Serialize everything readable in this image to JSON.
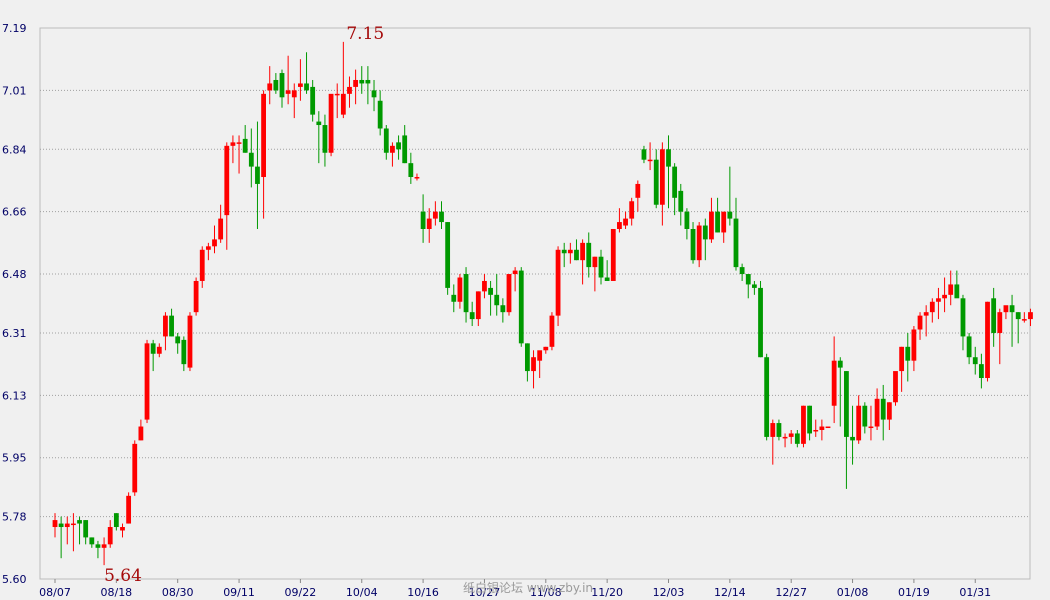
{
  "chart_data": {
    "type": "candlestick",
    "colors": {
      "up": "#ff0000",
      "down": "#009900",
      "grid": "#a0a0a0",
      "axis_label": "#000066",
      "extreme_label": "#a50a0a"
    },
    "grid": true,
    "ylim": [
      5.6,
      7.19
    ],
    "y_ticks": [
      "7.19",
      "7.01",
      "6.84",
      "6.66",
      "6.48",
      "6.31",
      "6.13",
      "5.95",
      "5.78",
      "5.60"
    ],
    "x_tick_labels": [
      "08/07",
      "08/18",
      "08/30",
      "09/11",
      "09/22",
      "10/04",
      "10/16",
      "10/27",
      "11/08",
      "11/20",
      "12/03",
      "12/14",
      "12/27",
      "01/08",
      "01/19",
      "01/31"
    ],
    "x_tick_index": [
      0,
      10,
      20,
      30,
      40,
      50,
      60,
      70,
      80,
      90,
      100,
      110,
      120,
      130,
      140,
      150
    ],
    "annotations": {
      "max_label": "7.15",
      "max_index": 47,
      "min_label": "5.64",
      "min_index": 8
    },
    "watermark": "纸白银论坛 www.zby.in",
    "candles": [
      [
        5.75,
        5.79,
        5.72,
        5.77
      ],
      [
        5.76,
        5.78,
        5.66,
        5.75
      ],
      [
        5.75,
        5.78,
        5.7,
        5.76
      ],
      [
        5.76,
        5.79,
        5.68,
        5.76
      ],
      [
        5.77,
        5.78,
        5.7,
        5.76
      ],
      [
        5.77,
        5.77,
        5.7,
        5.72
      ],
      [
        5.72,
        5.72,
        5.69,
        5.7
      ],
      [
        5.7,
        5.71,
        5.66,
        5.69
      ],
      [
        5.69,
        5.72,
        5.64,
        5.7
      ],
      [
        5.7,
        5.77,
        5.69,
        5.75
      ],
      [
        5.79,
        5.79,
        5.74,
        5.75
      ],
      [
        5.74,
        5.76,
        5.72,
        5.75
      ],
      [
        5.76,
        5.85,
        5.76,
        5.84
      ],
      [
        5.85,
        6.0,
        5.84,
        5.99
      ],
      [
        6.0,
        6.06,
        6.0,
        6.04
      ],
      [
        6.06,
        6.29,
        6.05,
        6.28
      ],
      [
        6.28,
        6.29,
        6.2,
        6.25
      ],
      [
        6.25,
        6.28,
        6.24,
        6.27
      ],
      [
        6.3,
        6.37,
        6.26,
        6.36
      ],
      [
        6.36,
        6.38,
        6.3,
        6.3
      ],
      [
        6.3,
        6.31,
        6.25,
        6.28
      ],
      [
        6.29,
        6.3,
        6.2,
        6.22
      ],
      [
        6.21,
        6.37,
        6.2,
        6.36
      ],
      [
        6.37,
        6.47,
        6.36,
        6.46
      ],
      [
        6.46,
        6.56,
        6.44,
        6.55
      ],
      [
        6.55,
        6.57,
        6.52,
        6.56
      ],
      [
        6.56,
        6.62,
        6.54,
        6.58
      ],
      [
        6.58,
        6.68,
        6.57,
        6.64
      ],
      [
        6.65,
        6.86,
        6.55,
        6.85
      ],
      [
        6.85,
        6.88,
        6.8,
        6.86
      ],
      [
        6.86,
        6.88,
        6.77,
        6.86
      ],
      [
        6.87,
        6.91,
        6.83,
        6.83
      ],
      [
        6.83,
        6.9,
        6.73,
        6.79
      ],
      [
        6.79,
        6.92,
        6.61,
        6.74
      ],
      [
        6.76,
        7.01,
        6.64,
        7.0
      ],
      [
        7.01,
        7.08,
        6.97,
        7.03
      ],
      [
        7.04,
        7.06,
        7.0,
        7.01
      ],
      [
        7.06,
        7.07,
        6.96,
        6.99
      ],
      [
        7.0,
        7.11,
        6.97,
        7.01
      ],
      [
        6.99,
        7.03,
        6.93,
        7.01
      ],
      [
        7.02,
        7.1,
        6.98,
        7.03
      ],
      [
        7.03,
        7.12,
        7.0,
        7.01
      ],
      [
        7.02,
        7.04,
        6.92,
        6.94
      ],
      [
        6.92,
        6.95,
        6.8,
        6.91
      ],
      [
        6.91,
        6.94,
        6.79,
        6.83
      ],
      [
        6.83,
        6.98,
        6.82,
        7.0
      ],
      [
        7.0,
        7.03,
        6.93,
        7.0
      ],
      [
        6.94,
        7.15,
        6.93,
        7.0
      ],
      [
        7.0,
        7.05,
        6.96,
        7.02
      ],
      [
        7.02,
        7.07,
        6.97,
        7.04
      ],
      [
        7.04,
        7.08,
        7.0,
        7.03
      ],
      [
        7.04,
        7.08,
        6.97,
        7.03
      ],
      [
        7.01,
        7.04,
        6.95,
        6.99
      ],
      [
        6.98,
        7.01,
        6.88,
        6.9
      ],
      [
        6.9,
        6.91,
        6.81,
        6.83
      ],
      [
        6.83,
        6.86,
        6.79,
        6.85
      ],
      [
        6.86,
        6.88,
        6.81,
        6.84
      ],
      [
        6.88,
        6.91,
        6.8,
        6.8
      ],
      [
        6.8,
        6.83,
        6.74,
        6.76
      ],
      [
        6.76,
        6.77,
        6.75,
        6.76
      ],
      [
        6.66,
        6.71,
        6.57,
        6.61
      ],
      [
        6.61,
        6.67,
        6.57,
        6.64
      ],
      [
        6.64,
        6.69,
        6.62,
        6.66
      ],
      [
        6.66,
        6.69,
        6.61,
        6.63
      ],
      [
        6.63,
        6.63,
        6.42,
        6.44
      ],
      [
        6.42,
        6.45,
        6.37,
        6.4
      ],
      [
        6.4,
        6.48,
        6.38,
        6.47
      ],
      [
        6.48,
        6.5,
        6.34,
        6.37
      ],
      [
        6.37,
        6.4,
        6.33,
        6.35
      ],
      [
        6.35,
        6.43,
        6.33,
        6.43
      ],
      [
        6.43,
        6.48,
        6.41,
        6.46
      ],
      [
        6.44,
        6.46,
        6.36,
        6.42
      ],
      [
        6.42,
        6.48,
        6.36,
        6.39
      ],
      [
        6.39,
        6.41,
        6.34,
        6.37
      ],
      [
        6.37,
        6.48,
        6.36,
        6.48
      ],
      [
        6.48,
        6.5,
        6.43,
        6.49
      ],
      [
        6.49,
        6.5,
        6.27,
        6.28
      ],
      [
        6.28,
        6.28,
        6.17,
        6.2
      ],
      [
        6.2,
        6.26,
        6.15,
        6.24
      ],
      [
        6.23,
        6.25,
        6.18,
        6.26
      ],
      [
        6.26,
        6.27,
        6.25,
        6.27
      ],
      [
        6.27,
        6.37,
        6.26,
        6.36
      ],
      [
        6.36,
        6.56,
        6.33,
        6.55
      ],
      [
        6.55,
        6.57,
        6.5,
        6.54
      ],
      [
        6.54,
        6.57,
        6.51,
        6.55
      ],
      [
        6.55,
        6.58,
        6.52,
        6.52
      ],
      [
        6.52,
        6.58,
        6.45,
        6.57
      ],
      [
        6.57,
        6.6,
        6.47,
        6.5
      ],
      [
        6.5,
        6.53,
        6.43,
        6.53
      ],
      [
        6.53,
        6.55,
        6.45,
        6.47
      ],
      [
        6.47,
        6.52,
        6.46,
        6.46
      ],
      [
        6.46,
        6.61,
        6.47,
        6.61
      ],
      [
        6.61,
        6.67,
        6.6,
        6.63
      ],
      [
        6.62,
        6.66,
        6.61,
        6.64
      ],
      [
        6.64,
        6.7,
        6.62,
        6.69
      ],
      [
        6.7,
        6.75,
        6.66,
        6.74
      ],
      [
        6.84,
        6.85,
        6.8,
        6.81
      ],
      [
        6.81,
        6.86,
        6.78,
        6.81
      ],
      [
        6.81,
        6.84,
        6.67,
        6.68
      ],
      [
        6.68,
        6.86,
        6.62,
        6.84
      ],
      [
        6.84,
        6.88,
        6.67,
        6.79
      ],
      [
        6.79,
        6.8,
        6.65,
        6.7
      ],
      [
        6.72,
        6.74,
        6.62,
        6.66
      ],
      [
        6.66,
        6.67,
        6.58,
        6.61
      ],
      [
        6.61,
        6.63,
        6.51,
        6.52
      ],
      [
        6.52,
        6.63,
        6.5,
        6.62
      ],
      [
        6.62,
        6.64,
        6.52,
        6.58
      ],
      [
        6.58,
        6.7,
        6.57,
        6.66
      ],
      [
        6.66,
        6.7,
        6.6,
        6.6
      ],
      [
        6.6,
        6.65,
        6.57,
        6.66
      ],
      [
        6.66,
        6.79,
        6.62,
        6.64
      ],
      [
        6.64,
        6.7,
        6.49,
        6.5
      ],
      [
        6.5,
        6.51,
        6.46,
        6.48
      ],
      [
        6.48,
        6.48,
        6.41,
        6.45
      ],
      [
        6.45,
        6.46,
        6.42,
        6.44
      ],
      [
        6.44,
        6.46,
        6.24,
        6.24
      ],
      [
        6.24,
        6.25,
        6.0,
        6.01
      ],
      [
        6.01,
        6.06,
        5.93,
        6.05
      ],
      [
        6.05,
        6.06,
        6.0,
        6.01
      ],
      [
        6.01,
        6.02,
        5.98,
        6.01
      ],
      [
        6.01,
        6.03,
        5.99,
        6.02
      ],
      [
        6.02,
        6.03,
        5.98,
        5.99
      ],
      [
        5.99,
        6.1,
        5.98,
        6.1
      ],
      [
        6.1,
        6.1,
        6.0,
        6.02
      ],
      [
        6.03,
        6.06,
        6.01,
        6.03
      ],
      [
        6.03,
        6.06,
        6.0,
        6.04
      ],
      [
        6.04,
        6.04,
        6.04,
        6.04
      ],
      [
        6.1,
        6.3,
        6.05,
        6.23
      ],
      [
        6.23,
        6.24,
        6.04,
        6.21
      ],
      [
        6.2,
        6.2,
        5.86,
        6.01
      ],
      [
        6.01,
        6.1,
        5.93,
        6.0
      ],
      [
        6.0,
        6.13,
        5.99,
        6.1
      ],
      [
        6.1,
        6.11,
        6.02,
        6.04
      ],
      [
        6.04,
        6.1,
        6.0,
        6.04
      ],
      [
        6.04,
        6.15,
        6.03,
        6.12
      ],
      [
        6.12,
        6.16,
        6.0,
        6.06
      ],
      [
        6.06,
        6.11,
        6.03,
        6.11
      ],
      [
        6.11,
        6.18,
        6.1,
        6.2
      ],
      [
        6.2,
        6.27,
        6.14,
        6.27
      ],
      [
        6.27,
        6.31,
        6.17,
        6.23
      ],
      [
        6.23,
        6.33,
        6.2,
        6.32
      ],
      [
        6.32,
        6.37,
        6.29,
        6.36
      ],
      [
        6.36,
        6.39,
        6.3,
        6.37
      ],
      [
        6.37,
        6.41,
        6.34,
        6.4
      ],
      [
        6.4,
        6.44,
        6.35,
        6.41
      ],
      [
        6.41,
        6.47,
        6.37,
        6.42
      ],
      [
        6.42,
        6.49,
        6.39,
        6.45
      ],
      [
        6.45,
        6.49,
        6.43,
        6.41
      ],
      [
        6.41,
        6.42,
        6.26,
        6.3
      ],
      [
        6.3,
        6.31,
        6.22,
        6.24
      ],
      [
        6.24,
        6.27,
        6.19,
        6.22
      ],
      [
        6.22,
        6.25,
        6.15,
        6.18
      ],
      [
        6.18,
        6.4,
        6.17,
        6.4
      ],
      [
        6.41,
        6.44,
        6.27,
        6.31
      ],
      [
        6.31,
        6.38,
        6.22,
        6.37
      ],
      [
        6.37,
        6.38,
        6.35,
        6.39
      ],
      [
        6.39,
        6.42,
        6.27,
        6.37
      ],
      [
        6.37,
        6.37,
        6.28,
        6.35
      ],
      [
        6.35,
        6.37,
        6.34,
        6.35
      ],
      [
        6.35,
        6.38,
        6.33,
        6.37
      ]
    ]
  }
}
